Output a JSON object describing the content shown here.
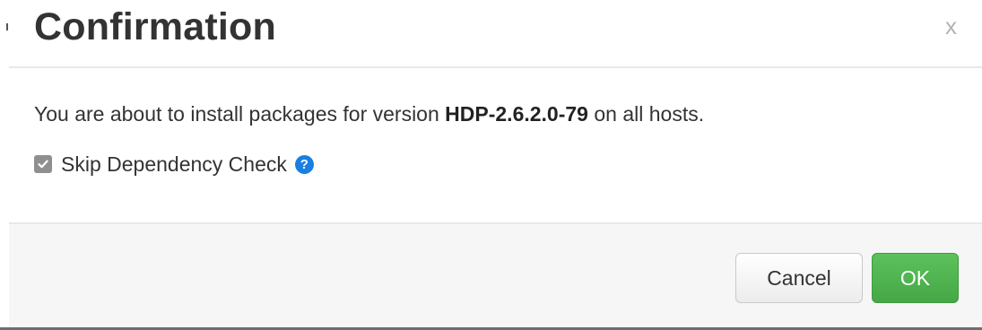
{
  "dialog": {
    "title": "Confirmation",
    "close_label": "x"
  },
  "message": {
    "prefix": "You are about to install packages for version ",
    "version": "HDP-2.6.2.0-79",
    "suffix": " on all hosts."
  },
  "skip_dependency_check": {
    "label": "Skip Dependency Check",
    "checked": true,
    "help_glyph": "?"
  },
  "footer": {
    "cancel_label": "Cancel",
    "ok_label": "OK"
  },
  "icons": {
    "checkbox": "checkbox-checked-icon",
    "help": "question-circle-icon"
  },
  "colors": {
    "ok_button": "#4cae4c",
    "help_icon": "#1a7fe0",
    "checkbox": "#8f8f8f"
  }
}
